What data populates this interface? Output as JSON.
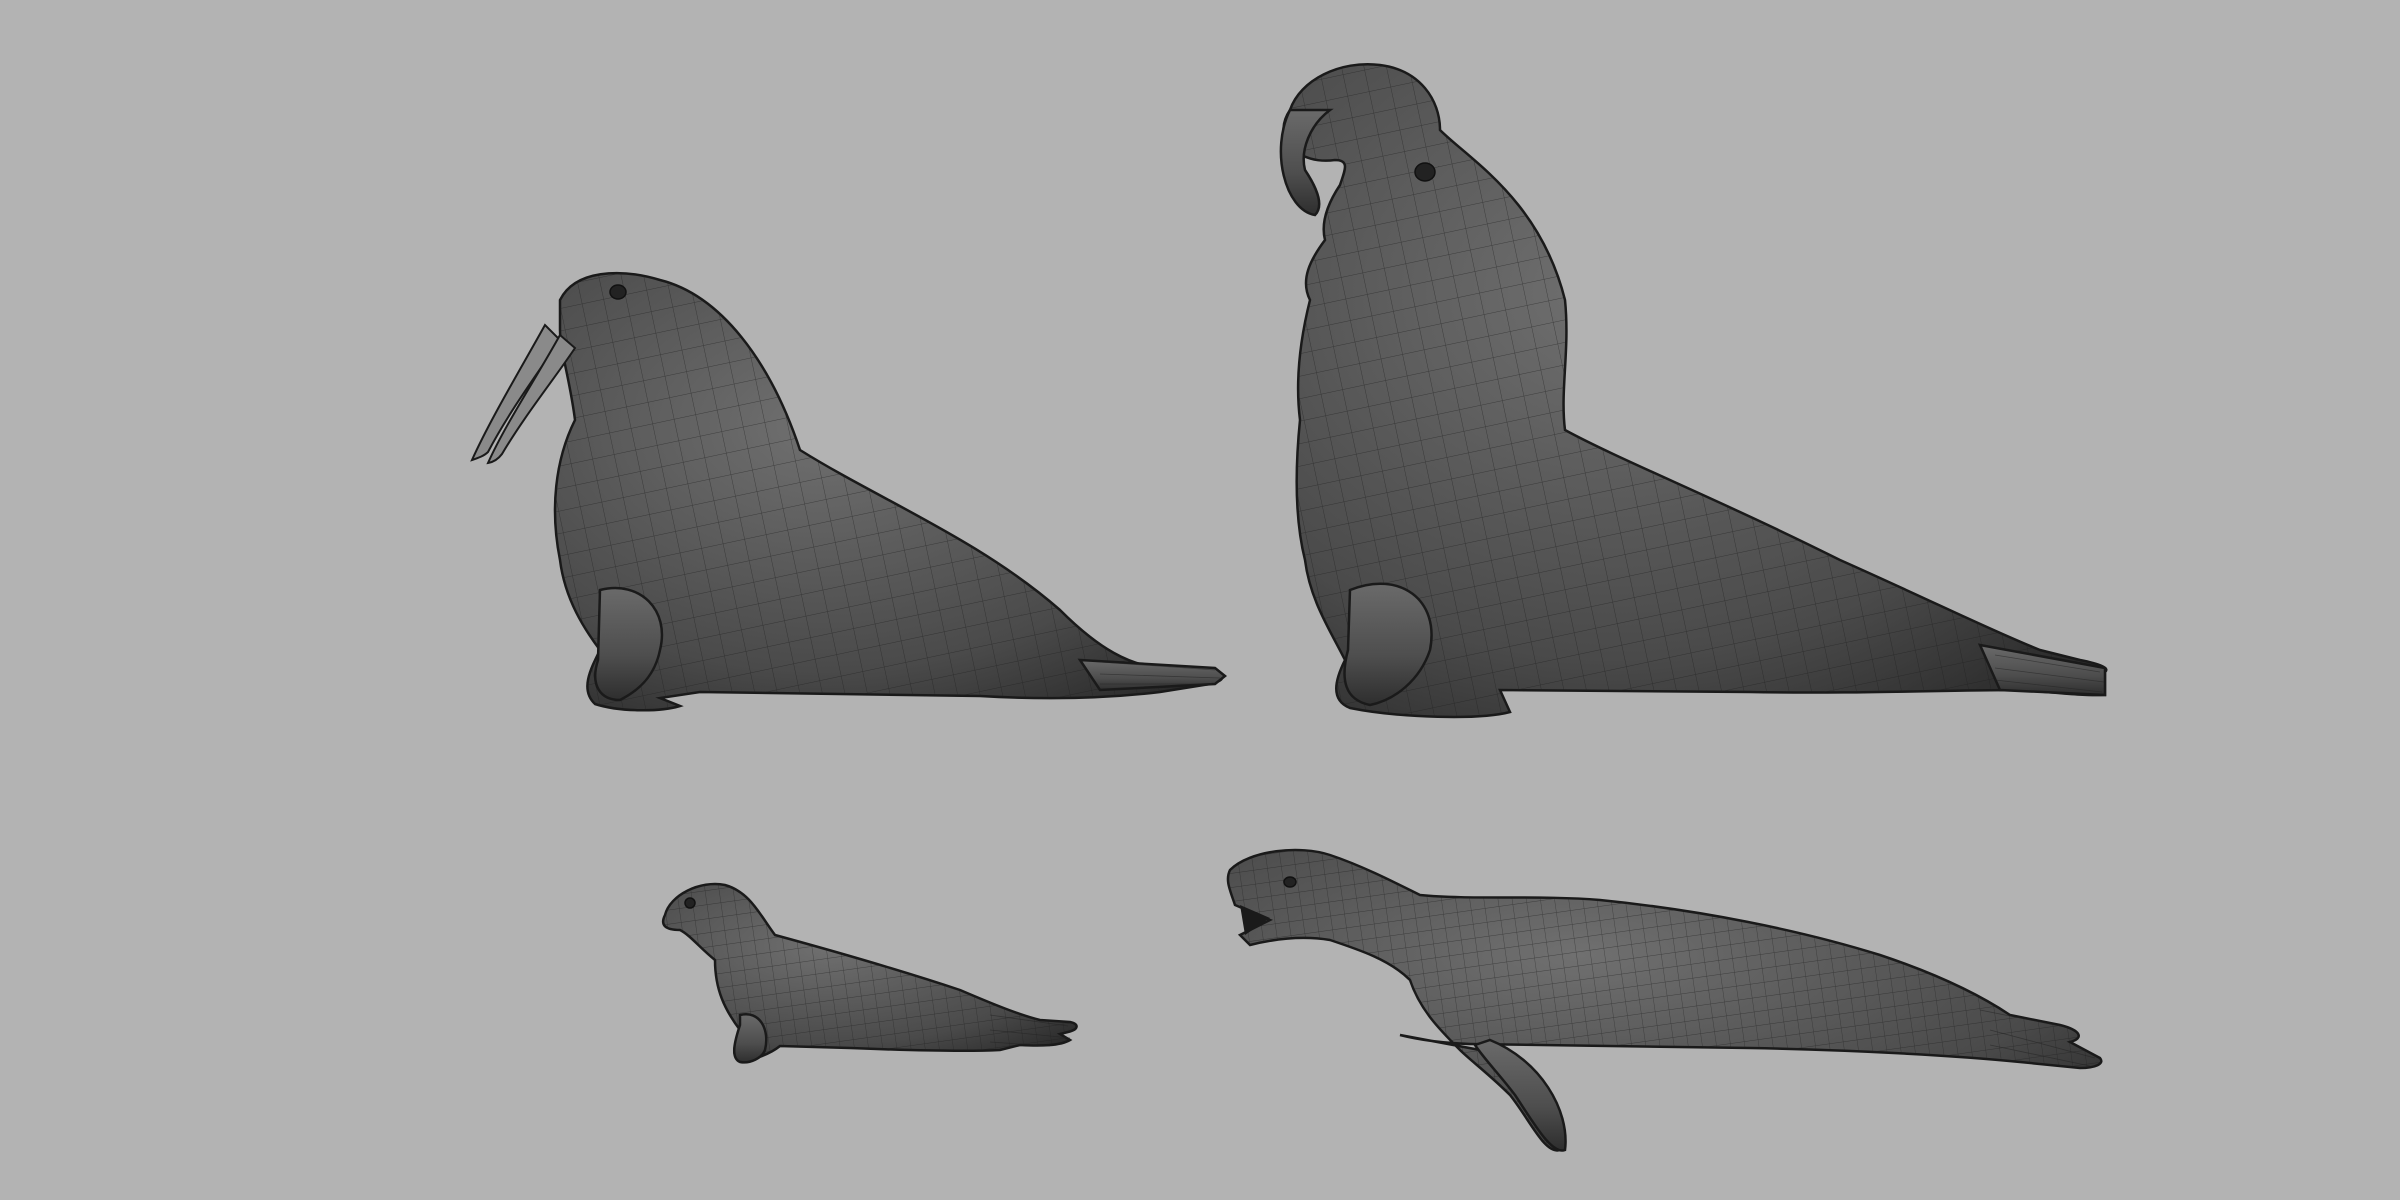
{
  "viewport": {
    "background_color": "#b3b3b3",
    "mesh_color": "#555555",
    "wire_color": "#222222"
  },
  "models": [
    {
      "name": "walrus",
      "icon": "walrus-mesh"
    },
    {
      "name": "elephant-seal-male",
      "icon": "elephant-seal-mesh"
    },
    {
      "name": "seal-pup",
      "icon": "seal-pup-mesh"
    },
    {
      "name": "leopard-seal",
      "icon": "leopard-seal-mesh"
    }
  ]
}
